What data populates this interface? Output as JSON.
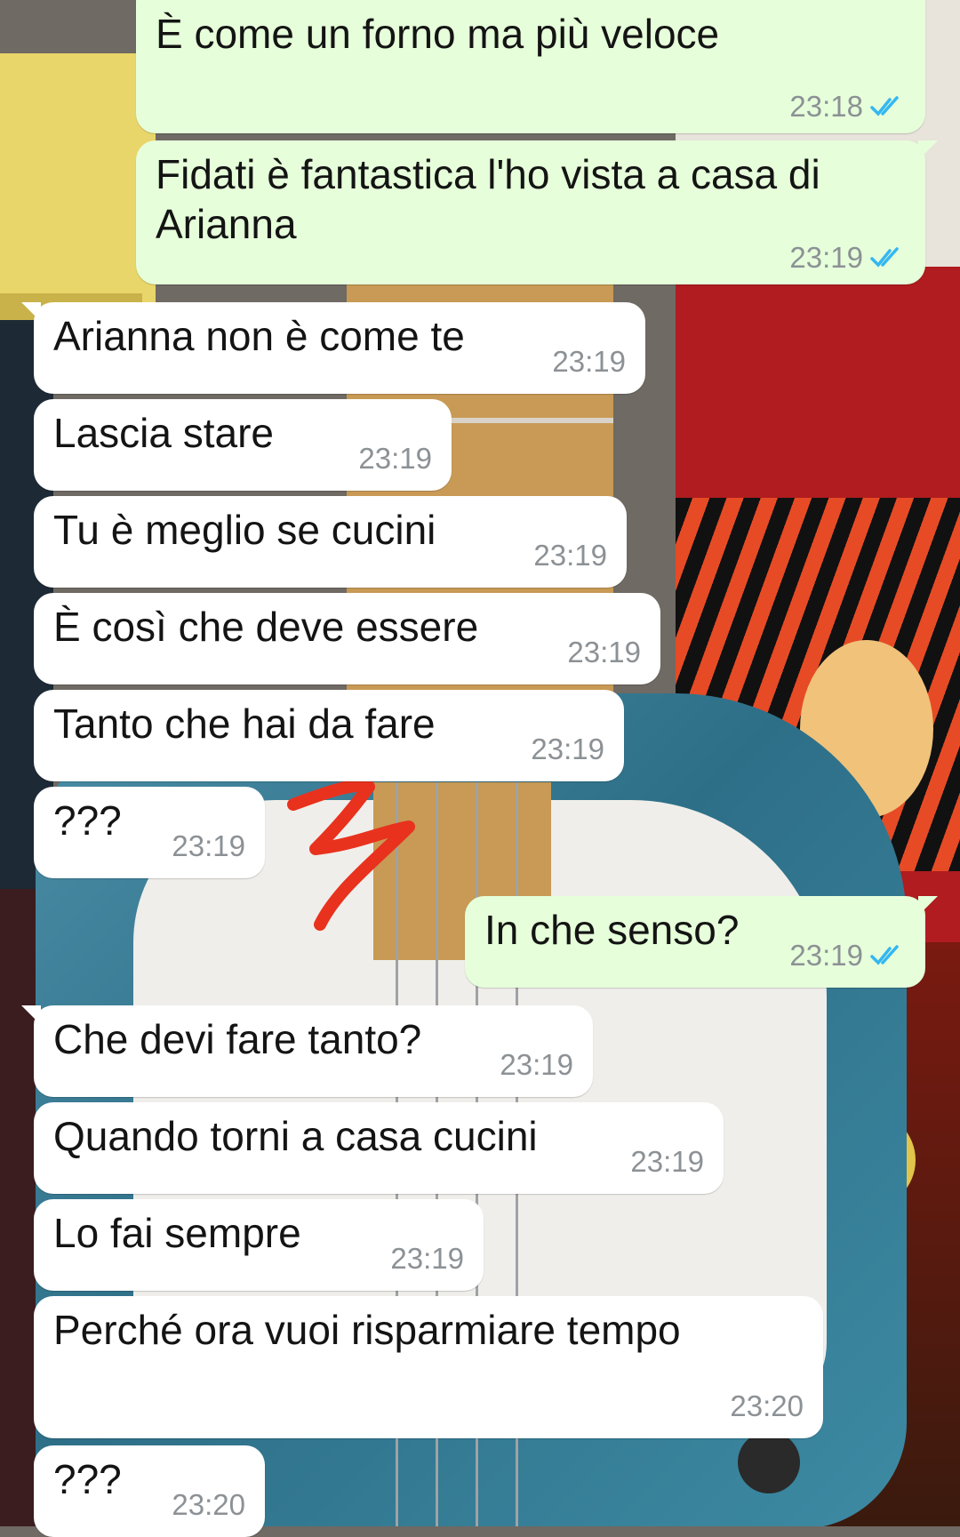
{
  "colors": {
    "outgoing_bubble": "#e6ffda",
    "incoming_bubble": "#ffffff",
    "timestamp": "#8c9195",
    "read_ticks": "#34b7f1",
    "doodle": "#e8321e"
  },
  "messages": [
    {
      "direction": "out",
      "text": "È come un forno ma più veloce",
      "time": "23:18",
      "status": "read-double-check-icon"
    },
    {
      "direction": "out",
      "text": "Fidati è fantastica l'ho vista a casa di Arianna",
      "time": "23:19",
      "status": "read-double-check-icon"
    },
    {
      "direction": "in",
      "text": "Arianna non è come te",
      "time": "23:19"
    },
    {
      "direction": "in",
      "text": "Lascia stare",
      "time": "23:19"
    },
    {
      "direction": "in",
      "text": "Tu è meglio se cucini",
      "time": "23:19"
    },
    {
      "direction": "in",
      "text": "È così che deve essere",
      "time": "23:19"
    },
    {
      "direction": "in",
      "text": "Tanto che hai da fare",
      "time": "23:19"
    },
    {
      "direction": "in",
      "text": "???",
      "time": "23:19"
    },
    {
      "direction": "out",
      "text": "In che senso?",
      "time": "23:19",
      "status": "read-double-check-icon"
    },
    {
      "direction": "in",
      "text": "Che devi fare tanto?",
      "time": "23:19"
    },
    {
      "direction": "in",
      "text": "Quando torni a casa cucini",
      "time": "23:19"
    },
    {
      "direction": "in",
      "text": "Lo fai sempre",
      "time": "23:19"
    },
    {
      "direction": "in",
      "text": "Perché ora vuoi risparmiare tempo",
      "time": "23:20"
    },
    {
      "direction": "in",
      "text": "???",
      "time": "23:20"
    }
  ]
}
